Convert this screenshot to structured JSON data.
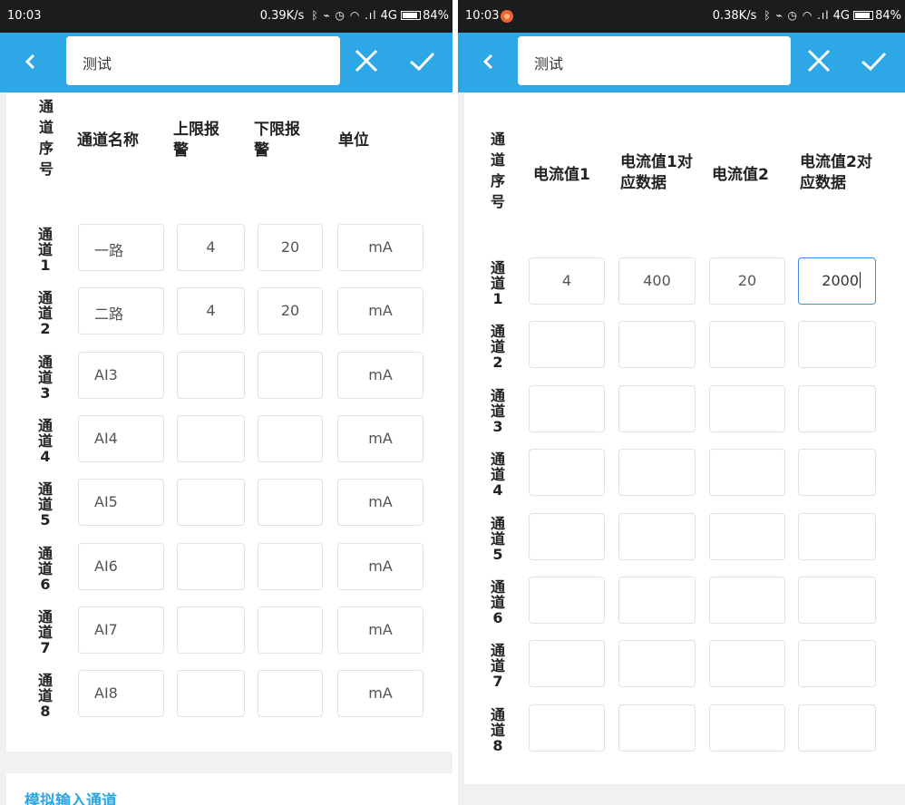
{
  "colors": {
    "accent": "#2ea7e6",
    "statusbar": "#1c1c1c",
    "background": "#f1f1f1",
    "focus_border": "#3a8ee6",
    "record_dot": "#f0642f"
  },
  "icons": {
    "back": "chevron-left-icon",
    "close": "close-icon",
    "confirm": "check-icon",
    "bluetooth": "bluetooth-icon",
    "battery": "battery-icon"
  },
  "left": {
    "status": {
      "time": "10:03",
      "speed": "0.39K/s",
      "network": "4G",
      "battery": "84%"
    },
    "search_text": "测试",
    "headers": [
      "通道序号",
      "通道名称",
      "上限报警",
      "下限报警",
      "单位"
    ],
    "rows": [
      {
        "label": "通道1",
        "name": "一路",
        "high": "4",
        "low": "20",
        "unit": "mA"
      },
      {
        "label": "通道2",
        "name": "二路",
        "high": "4",
        "low": "20",
        "unit": "mA"
      },
      {
        "label": "通道3",
        "name": "AI3",
        "high": "",
        "low": "",
        "unit": "mA"
      },
      {
        "label": "通道4",
        "name": "AI4",
        "high": "",
        "low": "",
        "unit": "mA"
      },
      {
        "label": "通道5",
        "name": "AI5",
        "high": "",
        "low": "",
        "unit": "mA"
      },
      {
        "label": "通道6",
        "name": "AI6",
        "high": "",
        "low": "",
        "unit": "mA"
      },
      {
        "label": "通道7",
        "name": "AI7",
        "high": "",
        "low": "",
        "unit": "mA"
      },
      {
        "label": "通道8",
        "name": "AI8",
        "high": "",
        "low": "",
        "unit": "mA"
      }
    ],
    "section_title": "模拟输入通道"
  },
  "right": {
    "status": {
      "time": "10:03",
      "speed": "0.38K/s",
      "network": "4G",
      "battery": "84%"
    },
    "search_text": "测试",
    "headers": [
      "通道序号",
      "电流值1",
      "电流值1对应数据",
      "电流值2",
      "电流值2对应数据"
    ],
    "rows": [
      {
        "label": "通道1",
        "c1": "4",
        "d1": "400",
        "c2": "20",
        "d2": "2000"
      },
      {
        "label": "通道2",
        "c1": "",
        "d1": "",
        "c2": "",
        "d2": ""
      },
      {
        "label": "通道3",
        "c1": "",
        "d1": "",
        "c2": "",
        "d2": ""
      },
      {
        "label": "通道4",
        "c1": "",
        "d1": "",
        "c2": "",
        "d2": ""
      },
      {
        "label": "通道5",
        "c1": "",
        "d1": "",
        "c2": "",
        "d2": ""
      },
      {
        "label": "通道6",
        "c1": "",
        "d1": "",
        "c2": "",
        "d2": ""
      },
      {
        "label": "通道7",
        "c1": "",
        "d1": "",
        "c2": "",
        "d2": ""
      },
      {
        "label": "通道8",
        "c1": "",
        "d1": "",
        "c2": "",
        "d2": ""
      }
    ],
    "focused_field": "d2"
  }
}
